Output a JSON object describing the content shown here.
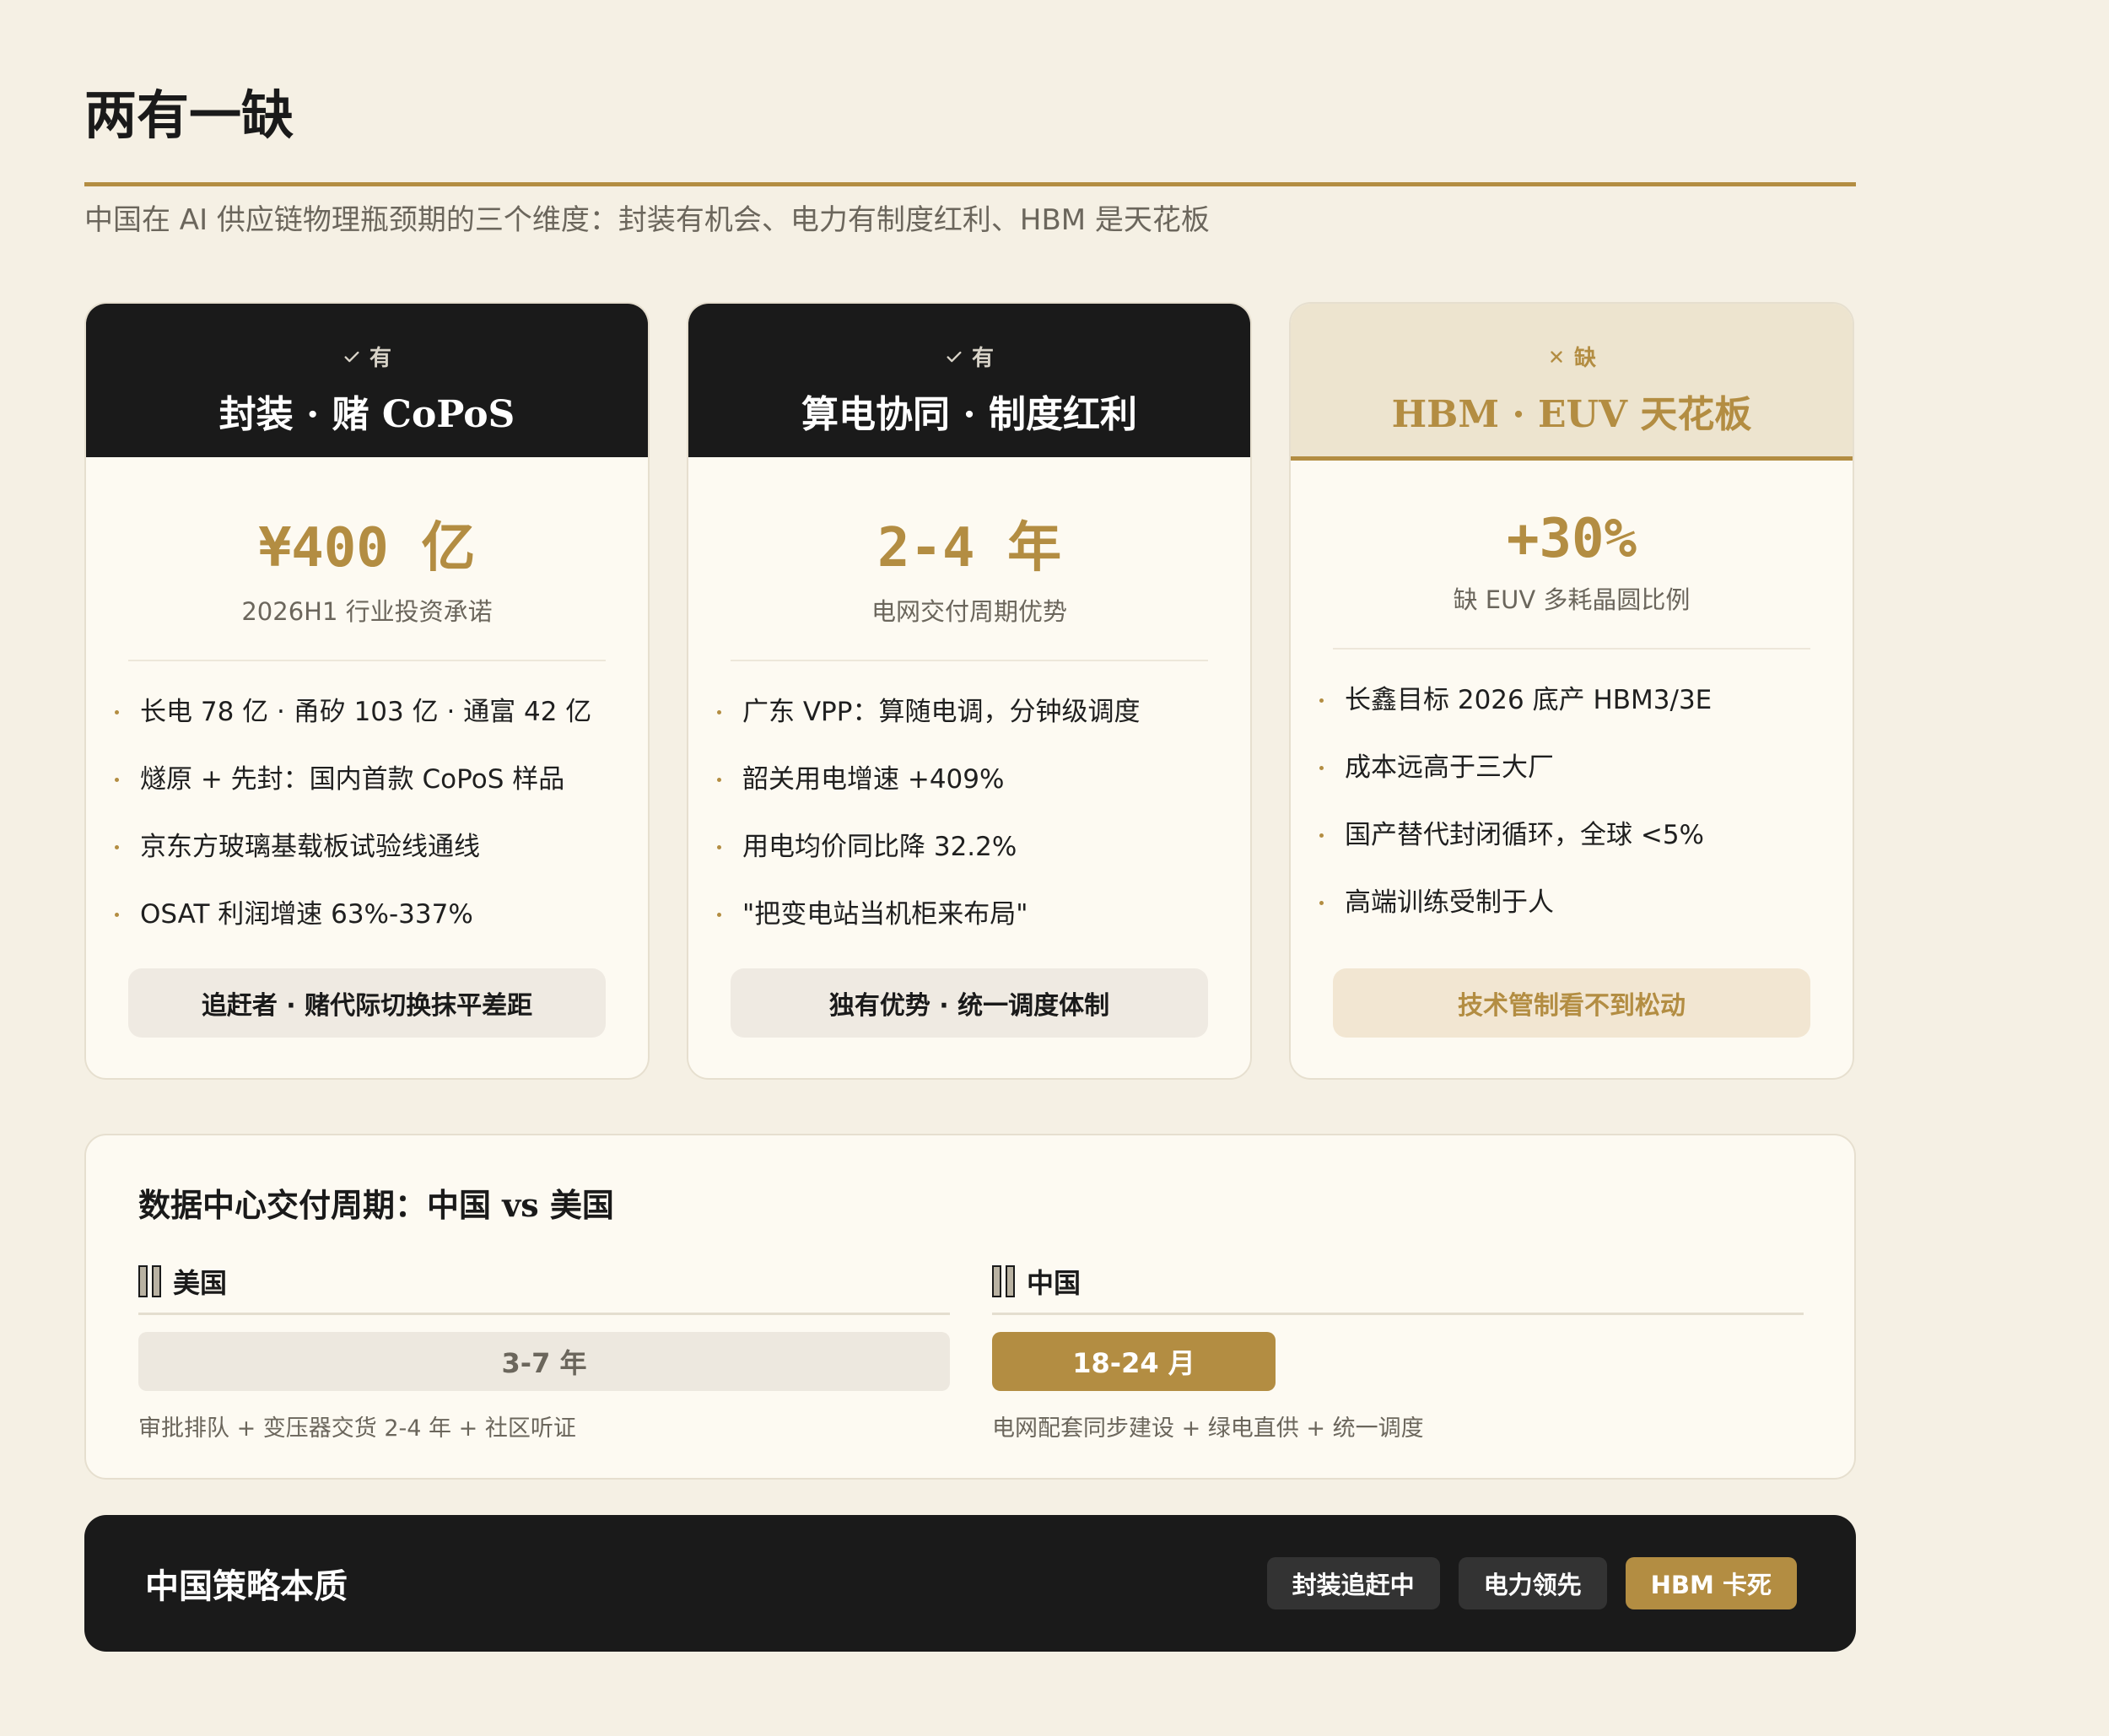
{
  "title": "两有一缺",
  "subtitle": "中国在 AI 供应链物理瓶颈期的三个维度：封装有机会、电力有制度红利、HBM 是天花板",
  "colors": {
    "accent": "#B38D42",
    "dark": "#1A1A1A",
    "background": "#F5F0E4"
  },
  "cards": [
    {
      "status": "有",
      "status_icon": "check-icon",
      "title": "封装 · 赌 CoPoS",
      "metric": "¥400 亿",
      "metric_label": "2026H1 行业投资承诺",
      "bullets": [
        "长电 78 亿 · 甬矽 103 亿 · 通富 42 亿",
        "燧原 + 先封：国内首款 CoPoS 样品",
        "京东方玻璃基载板试验线通线",
        "OSAT 利润增速 63%-337%"
      ],
      "verdict": "追赶者 · 赌代际切换抹平差距"
    },
    {
      "status": "有",
      "status_icon": "check-icon",
      "title": "算电协同 · 制度红利",
      "metric": "2-4 年",
      "metric_label": "电网交付周期优势",
      "bullets": [
        "广东 VPP：算随电调，分钟级调度",
        "韶关用电增速 +409%",
        "用电均价同比降 32.2%",
        "\"把变电站当机柜来布局\""
      ],
      "verdict": "独有优势 · 统一调度体制"
    },
    {
      "status": "缺",
      "status_icon": "cross-icon",
      "title": "HBM · EUV 天花板",
      "metric": "+30%",
      "metric_label": "缺 EUV 多耗晶圆比例",
      "bullets": [
        "长鑫目标 2026 底产 HBM3/3E",
        "成本远高于三大厂",
        "国产替代封闭循环，全球 <5%",
        "高端训练受制于人"
      ],
      "verdict": "技术管制看不到松动"
    }
  ],
  "compare": {
    "title": "数据中心交付周期：中国 vs 美国",
    "us": {
      "label": "美国",
      "value": "3-7 年",
      "note": "审批排队 + 变压器交货 2-4 年 + 社区听证"
    },
    "cn": {
      "label": "中国",
      "value": "18-24 月",
      "note": "电网配套同步建设 + 绿电直供 + 统一调度"
    }
  },
  "footer": {
    "title": "中国策略本质",
    "pills": [
      "封装追赶中",
      "电力领先",
      "HBM 卡死"
    ]
  }
}
